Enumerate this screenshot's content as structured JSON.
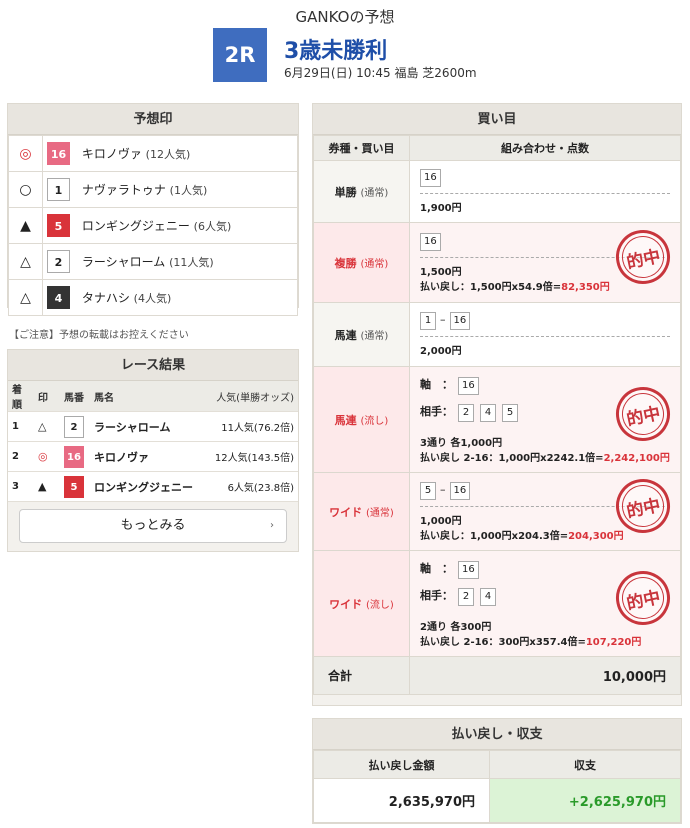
{
  "header": {
    "title": "GANKOの予想",
    "race_no": "2R",
    "race_name": "3歳未勝利",
    "race_info": "6月29日(日) 10:45 福島 芝2600m"
  },
  "prediction": {
    "title": "予想印",
    "rows": [
      {
        "mark": "◎",
        "number": "16",
        "color": "pink",
        "horse": "キロノヴァ",
        "pop": "(12人気)"
      },
      {
        "mark": "○",
        "number": "1",
        "color": "white",
        "horse": "ナヴァラトゥナ",
        "pop": "(1人気)"
      },
      {
        "mark": "▲",
        "number": "5",
        "color": "red",
        "horse": "ロンギングジェニー",
        "pop": "(6人気)"
      },
      {
        "mark": "△",
        "number": "2",
        "color": "white",
        "horse": "ラーシャローム",
        "pop": "(11人気)"
      },
      {
        "mark": "△",
        "number": "4",
        "color": "black",
        "horse": "タナハシ",
        "pop": "(4人気)"
      }
    ],
    "note": "【ご注意】予想の転載はお控えください"
  },
  "results": {
    "title": "レース結果",
    "headers": [
      "着順",
      "印",
      "馬番",
      "馬名",
      "人気(単勝オッズ)"
    ],
    "rows": [
      {
        "rank": "1",
        "mark": "△",
        "number": "2",
        "color": "white",
        "horse": "ラーシャローム",
        "pop": "11人気(76.2倍)"
      },
      {
        "rank": "2",
        "mark": "◎",
        "number": "16",
        "color": "pink",
        "horse": "キロノヴァ",
        "pop": "12人気(143.5倍)"
      },
      {
        "rank": "3",
        "mark": "▲",
        "number": "5",
        "color": "red",
        "horse": "ロンギングジェニー",
        "pop": "6人気(23.8倍)"
      }
    ],
    "more_label": "もっとみる",
    "more_icon": "chevron-right-icon"
  },
  "bets": {
    "title": "買い目",
    "col1": "券種・買い目",
    "col2": "組み合わせ・点数",
    "hit_label": "的中",
    "rows": [
      {
        "type": "単勝",
        "sub": "(通常)",
        "hit": false,
        "nums": "16",
        "amount": "1,900円"
      },
      {
        "type": "複勝",
        "sub": "(通常)",
        "hit": true,
        "nums": "16",
        "amount": "1,500円",
        "refund_pre": "払い戻し：1,500円x54.9倍=",
        "refund_val": "82,350円"
      },
      {
        "type": "馬連",
        "sub": "(通常)",
        "hit": false,
        "nums_a": "1",
        "sep": "–",
        "nums_b": "16",
        "amount": "2,000円"
      },
      {
        "type": "馬連",
        "sub": "(流し)",
        "hit": true,
        "axis_label": "軸　：",
        "axis": "16",
        "partner_label": "相手：",
        "partners": [
          "2",
          "4",
          "5"
        ],
        "amount": "3通り 各1,000円",
        "refund_pre": "払い戻し 2-16：1,000円x2242.1倍=",
        "refund_val": "2,242,100円"
      },
      {
        "type": "ワイド",
        "sub": "(通常)",
        "hit": true,
        "nums_a": "5",
        "sep": "–",
        "nums_b": "16",
        "amount": "1,000円",
        "refund_pre": "払い戻し：1,000円x204.3倍=",
        "refund_val": "204,300円"
      },
      {
        "type": "ワイド",
        "sub": "(流し)",
        "hit": true,
        "axis_label": "軸　：",
        "axis": "16",
        "partner_label": "相手：",
        "partners": [
          "2",
          "4"
        ],
        "amount": "2通り 各300円",
        "refund_pre": "払い戻し 2-16：300円x357.4倍=",
        "refund_val": "107,220円"
      }
    ],
    "total_label": "合計",
    "total_value": "10,000円"
  },
  "returns": {
    "title": "払い戻し・収支",
    "col1": "払い戻し金額",
    "col2": "収支",
    "refund": "2,635,970円",
    "profit": "+2,625,970円"
  },
  "colors": {
    "accent": "#3f6dbf",
    "hit_red": "#d9333a",
    "profit_bg": "#dcf3d6",
    "profit_text": "#2a9a2a"
  }
}
